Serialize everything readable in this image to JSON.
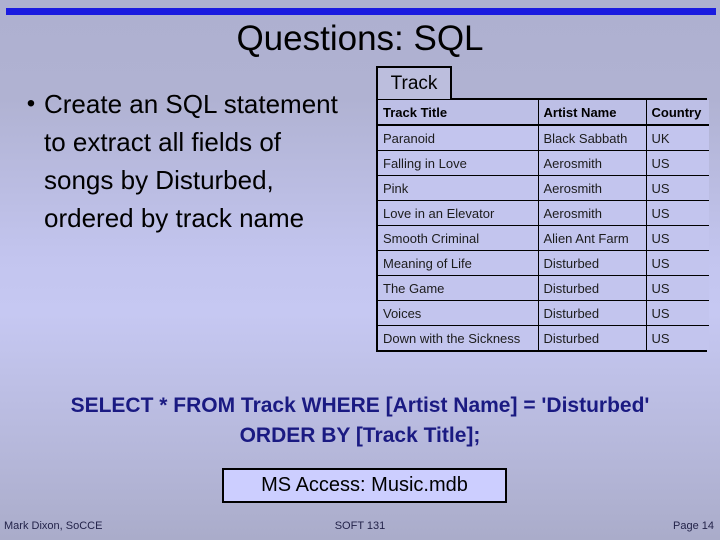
{
  "slide": {
    "title": "Questions: SQL",
    "accent_bar_color": "#1a1ae0",
    "background_color": "#c3c5ef"
  },
  "bullets": [
    {
      "marker": "•",
      "text": "Create an SQL statement to extract all fields of songs by Disturbed, ordered by track name"
    }
  ],
  "table": {
    "tab_label": "Track",
    "columns": [
      "Track Title",
      "Artist Name",
      "Country"
    ],
    "rows": [
      [
        "Paranoid",
        "Black Sabbath",
        "UK"
      ],
      [
        "Falling in Love",
        "Aerosmith",
        "US"
      ],
      [
        "Pink",
        "Aerosmith",
        "US"
      ],
      [
        "Love in an Elevator",
        "Aerosmith",
        "US"
      ],
      [
        "Smooth Criminal",
        "Alien Ant Farm",
        "US"
      ],
      [
        "Meaning of Life",
        "Disturbed",
        "US"
      ],
      [
        "The Game",
        "Disturbed",
        "US"
      ],
      [
        "Voices",
        "Disturbed",
        "US"
      ],
      [
        "Down with the Sickness",
        "Disturbed",
        "US"
      ]
    ]
  },
  "answer": {
    "line1": "SELECT * FROM Track WHERE [Artist Name] = 'Disturbed'",
    "line2": "ORDER BY [Track Title];",
    "color": "#1a1a82"
  },
  "caption": {
    "text": "MS Access: Music.mdb"
  },
  "footer": {
    "left": "Mark Dixon, SoCCE",
    "center": "SOFT 131",
    "right": "Page 14"
  }
}
